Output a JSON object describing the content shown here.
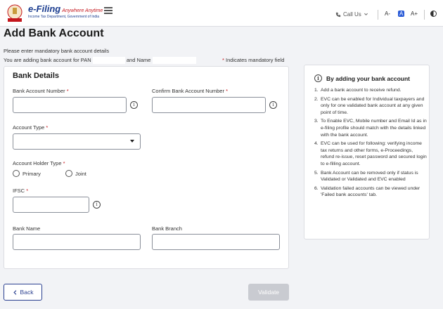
{
  "header": {
    "brand_title": "e-Filing",
    "brand_tagline": "Anywhere Anytime",
    "brand_subtitle": "Income Tax Department, Government of India",
    "call_us": "Call Us",
    "font_decrease": "A-",
    "font_normal": "A",
    "font_increase": "A+",
    "icons": {
      "menu": "hamburger-icon",
      "phone": "phone-icon",
      "contrast": "contrast-icon"
    },
    "colors": {
      "brand_blue": "#1a3c8f",
      "accent_red": "#c4161c"
    }
  },
  "page": {
    "title": "Add Bank Account",
    "instruction": "Please enter mandatory bank account details",
    "adding_prefix": "You are adding bank account for PAN",
    "adding_mid": "and Name",
    "mandatory_note": "Indicates mandatory field",
    "mandatory_marker": "*"
  },
  "form": {
    "section_title": "Bank Details",
    "bank_account_number_label": "Bank Account Number",
    "confirm_account_number_label": "Confirm Bank Account Number",
    "account_type_label": "Account Type",
    "account_type_value": "",
    "account_holder_type_label": "Account Holder Type",
    "holder_primary": "Primary",
    "holder_joint": "Joint",
    "ifsc_label": "IFSC",
    "bank_name_label": "Bank Name",
    "bank_branch_label": "Bank Branch"
  },
  "side_panel": {
    "title": "By adding your bank account",
    "items": [
      {
        "num": "1.",
        "text": "Add a bank account to receive refund."
      },
      {
        "num": "2.",
        "text": "EVC can be enabled for Individual taxpayers and only for one validated bank account at any given point of time."
      },
      {
        "num": "3.",
        "text": "To Enable EVC, Mobile number and Email Id as in e-filing profile should match with the details linked with the bank account."
      },
      {
        "num": "4.",
        "text": "EVC can be used for following: verifying income tax returns and other forms, e-Proceedings, refund re-issue, reset password and secured login to e-filling account."
      },
      {
        "num": "5.",
        "text": "Bank Account can be removed only if status is Validated or Validated and EVC enabled"
      },
      {
        "num": "6.",
        "text": "Validation failed accounts can be viewed under 'Failed bank accounts' tab."
      }
    ]
  },
  "actions": {
    "back": "Back",
    "validate": "Validate"
  }
}
